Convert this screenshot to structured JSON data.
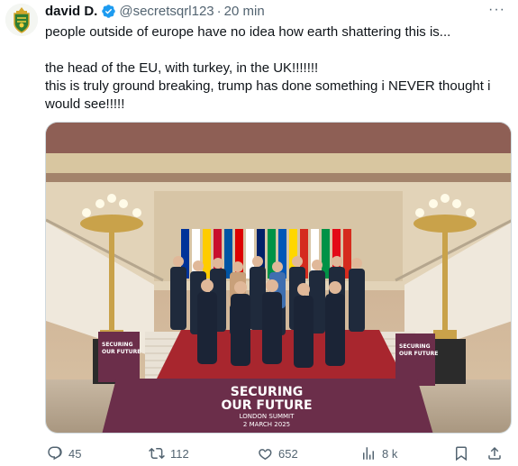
{
  "tweet": {
    "author": {
      "display_name": "david D.",
      "handle": "@secretsqrl123",
      "separator": "·",
      "time": "20 min",
      "verified": true,
      "avatar_icon": "coat-of-arms-avatar"
    },
    "text_lines": [
      "people outside of europe have no idea how earth shattering this is...",
      "the head of the EU, with turkey, in the UK!!!!!!!",
      "this is truly ground breaking, trump has done something i NEVER thought i",
      "would see!!!!!"
    ],
    "media": {
      "left_sign": [
        "SECURING",
        "OUR FUTURE"
      ],
      "right_sign": [
        "SECURING",
        "OUR FUTURE"
      ],
      "main_banner": {
        "line1": "SECURING",
        "line2": "OUR FUTURE",
        "line3": "LONDON SUMMIT",
        "line4": "2 MARCH 2025"
      },
      "banner_color": "#6b2e4a"
    },
    "stats": {
      "replies": "45",
      "reposts": "112",
      "likes": "652",
      "views": "8 k"
    },
    "colors": {
      "text": "#0f1419",
      "secondary": "#536471",
      "verified": "#1d9bf0"
    }
  }
}
